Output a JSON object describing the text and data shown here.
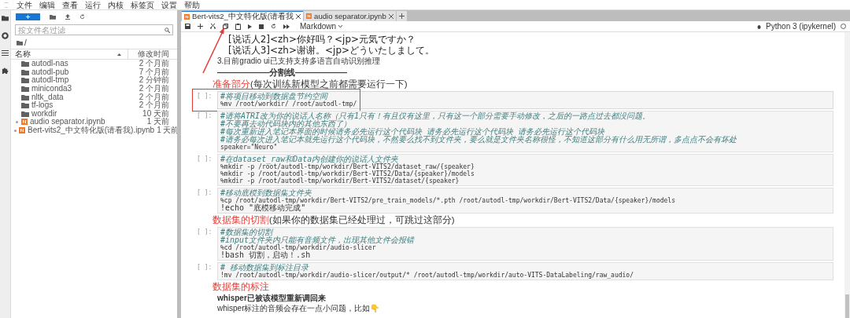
{
  "menu": [
    "文件",
    "编辑",
    "查看",
    "运行",
    "内核",
    "标签页",
    "设置",
    "帮助"
  ],
  "file_browser": {
    "filter": {
      "placeholder": "按文件名过滤"
    },
    "path": "/",
    "columns": [
      "名称",
      "修改时间"
    ],
    "rows": [
      {
        "kind": "folder",
        "name": "autodl-nas",
        "modified": "2 个月前"
      },
      {
        "kind": "folder",
        "name": "autodl-pub",
        "modified": "7 个月前"
      },
      {
        "kind": "folder",
        "name": "autodl-tmp",
        "modified": "2 分钟前"
      },
      {
        "kind": "folder",
        "name": "miniconda3",
        "modified": "2 个月前"
      },
      {
        "kind": "folder",
        "name": "nltk_data",
        "modified": "2 个月前"
      },
      {
        "kind": "folder",
        "name": "tf-logs",
        "modified": "2 个月前"
      },
      {
        "kind": "folder",
        "name": "workdir",
        "modified": "10 天前"
      },
      {
        "kind": "notebook",
        "name": "audio separator.ipynb",
        "modified": "1 天前"
      },
      {
        "kind": "notebook",
        "name": "Bert-vits2_中文特化版(请看我).ipynb",
        "modified": "1 天前"
      }
    ]
  },
  "tabs": [
    {
      "label": "Bert-vits2_中文特化版(请看我",
      "selected": true
    },
    {
      "label": "audio separator.ipynb",
      "selected": false
    }
  ],
  "toolbar": {
    "cell_type": "Markdown",
    "kernel": "Python 3 (ipykernel)"
  },
  "cells": [
    {
      "kind": "raw_lines",
      "lines": [
        "[说话人2]<zh>你好吗？<jp>元気ですか？",
        "[说话人3]<zh>谢谢。<jp>どういたしまして。"
      ]
    },
    {
      "kind": "paragraph",
      "text": "3.目前gradio ui已支持支持多语言自动识别推理"
    },
    {
      "kind": "divider_heading",
      "text": "——————分割线——————"
    },
    {
      "kind": "heading",
      "accent": "准备部分",
      "text": "(每次训练新模型之前都需要运行一下)"
    },
    {
      "kind": "code",
      "prompt": "[ ]:",
      "highlighted": true,
      "lines": [
        {
          "kind": "comment",
          "text": "#将项目移动到数据盘节约空间"
        },
        {
          "kind": "code",
          "text": "%mv /root/workdir/ /root/autodl-tmp/"
        }
      ]
    },
    {
      "kind": "code",
      "prompt": "[ ]:",
      "highlighted": false,
      "lines": [
        {
          "kind": "comment",
          "text": "#请将ATRI改为你的说话人名称（只有1只有！有且仅有这里，只有这一个部分需要手动修改，之后的一路点过去都没问题。"
        },
        {
          "kind": "comment",
          "text": "#不要再去动代码块内的其他东西了）"
        },
        {
          "kind": "comment",
          "text": "#每次重新进入笔记本界面的时候请务必先运行这个代码块 请务必先运行这个代码块 请务必先运行这个代码块"
        },
        {
          "kind": "comment",
          "text": "#请务必每次进入笔记本就先运行这个代码块，不然要么找不到文件夹，要么就是文件夹名称很怪，不知道这部分有什么用无所谓，多点点不会有坏处"
        },
        {
          "kind": "code",
          "text": "speaker=\"Neuro\""
        }
      ]
    },
    {
      "kind": "code",
      "prompt": "[ ]:",
      "highlighted": false,
      "lines": [
        {
          "kind": "comment",
          "text": "#在dataset_raw和Data内创建你的说话人文件夹"
        },
        {
          "kind": "code",
          "text": "%mkdir -p /root/autodl-tmp/workdir/Bert-VITS2/dataset_raw/{speaker}"
        },
        {
          "kind": "code",
          "text": "%mkdir -p /root/autodl-tmp/workdir/Bert-VITS2/Data/{speaker}/models"
        },
        {
          "kind": "code",
          "text": "%mkdir -p /root/autodl-tmp/workdir/Bert-VITS2/dataset/{speaker}"
        }
      ]
    },
    {
      "kind": "code",
      "prompt": "[ ]:",
      "highlighted": false,
      "lines": [
        {
          "kind": "comment",
          "text": "#移动底模到数据集文件夹"
        },
        {
          "kind": "code",
          "text": "%cp /root/autodl-tmp/workdir/Bert-VITS2/pre_train_models/*.pth /root/autodl-tmp/workdir/Bert-VITS2/Data/{speaker}/models"
        },
        {
          "kind": "code",
          "text": "!echo \"底模移动完成\""
        }
      ]
    },
    {
      "kind": "heading",
      "accent": "数据集的切割",
      "text": "(如果你的数据集已经处理过，可跳过这部分)"
    },
    {
      "kind": "code",
      "prompt": "[ ]:",
      "highlighted": false,
      "lines": [
        {
          "kind": "comment",
          "text": "#数据集的切割"
        },
        {
          "kind": "comment",
          "text": "#input文件夹内只能有音频文件，出现其他文件会报错"
        },
        {
          "kind": "code",
          "text": "%cd /root/autodl-tmp/workdir/audio-slicer"
        },
        {
          "kind": "code",
          "text": "!bash 切割，启动！.sh"
        }
      ]
    },
    {
      "kind": "code",
      "prompt": "[ ]:",
      "highlighted": false,
      "lines": [
        {
          "kind": "comment",
          "text": "# 移动数据集到标注目录"
        },
        {
          "kind": "code",
          "text": "!mv /root/autodl-tmp/workdir/audio-slicer/output/* /root/autodl-tmp/workdir/auto-VITS-DataLabeling/raw_audio/"
        }
      ]
    },
    {
      "kind": "heading",
      "accent": "数据集的标注",
      "text": ""
    },
    {
      "kind": "bold_paragraph",
      "text": "whisper已被该模型重新调回来"
    },
    {
      "kind": "paragraph",
      "text": "whisper标注的音频会存在一点小问题，比如👇"
    }
  ]
}
